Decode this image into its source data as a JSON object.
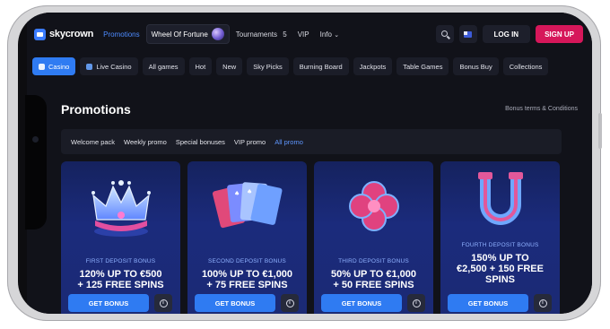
{
  "header": {
    "logo_text": "skycrown",
    "nav": [
      {
        "label": "Promotions",
        "active": true
      },
      {
        "label": "Wheel Of Fortune",
        "boxed": true
      },
      {
        "label": "Tournaments",
        "badge": "5"
      },
      {
        "label": "VIP"
      },
      {
        "label": "Info"
      }
    ],
    "login_label": "LOG IN",
    "signup_label": "SIGN UP"
  },
  "categories": [
    {
      "label": "Casino",
      "active": true
    },
    {
      "label": "Live Casino"
    },
    {
      "label": "All games"
    },
    {
      "label": "Hot"
    },
    {
      "label": "New"
    },
    {
      "label": "Sky Picks"
    },
    {
      "label": "Burning Board"
    },
    {
      "label": "Jackpots"
    },
    {
      "label": "Table Games"
    },
    {
      "label": "Bonus Buy"
    },
    {
      "label": "Collections"
    }
  ],
  "promotions": {
    "title": "Promotions",
    "terms_link": "Bonus terms & Conditions",
    "tabs": [
      {
        "label": "Welcome pack"
      },
      {
        "label": "Weekly promo"
      },
      {
        "label": "Special bonuses"
      },
      {
        "label": "VIP promo"
      },
      {
        "label": "All promo",
        "active": true
      }
    ],
    "cards": [
      {
        "label": "FIRST DEPOSIT BONUS",
        "offer_line1": "120% UP TO €500",
        "offer_line2": "+ 125 FREE SPINS",
        "button": "GET BONUS",
        "icon": "crown-icon"
      },
      {
        "label": "SECOND DEPOSIT BONUS",
        "offer_line1": "100% UP TO €1,000",
        "offer_line2": "+ 75 FREE SPINS",
        "button": "GET BONUS",
        "icon": "cards-icon"
      },
      {
        "label": "THIRD DEPOSIT BONUS",
        "offer_line1": "50% UP TO €1,000",
        "offer_line2": "+ 50 FREE SPINS",
        "button": "GET BONUS",
        "icon": "clover-icon"
      },
      {
        "label": "FOURTH DEPOSIT BONUS",
        "offer_line1": "150% UP TO",
        "offer_line2": "€2,500 + 150 FREE",
        "offer_line3": "SPINS",
        "button": "GET BONUS",
        "icon": "horseshoe-icon"
      }
    ]
  },
  "colors": {
    "accent_blue": "#2f7bf2",
    "signup_pink": "#d6175a",
    "card_bg": "#1b2b7c",
    "screen_bg": "#111219"
  }
}
